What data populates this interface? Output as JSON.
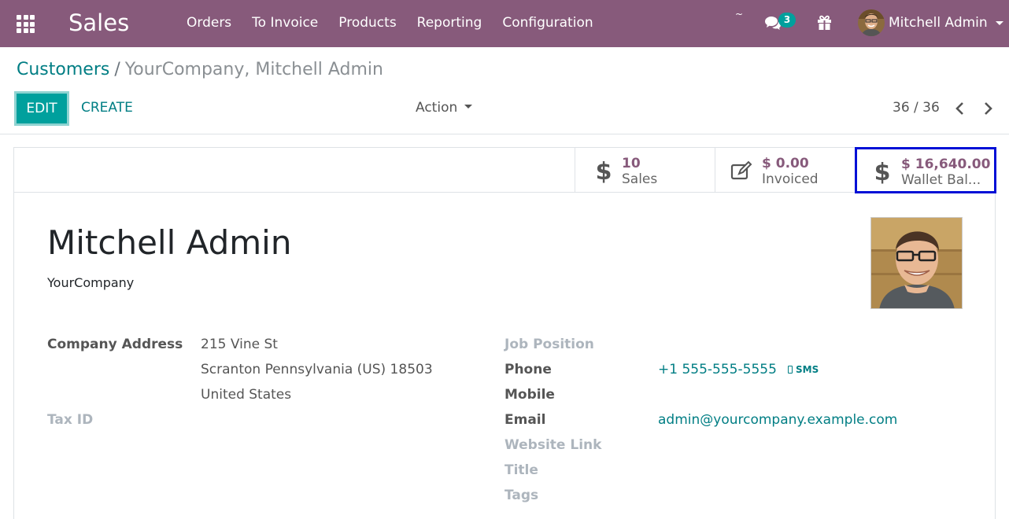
{
  "navbar": {
    "brand": "Sales",
    "menu": [
      "Orders",
      "To Invoice",
      "Products",
      "Reporting",
      "Configuration"
    ],
    "tilde": "~",
    "messages_count": "3",
    "user_name": "Mitchell Admin",
    "colors": {
      "bar": "#875a7b",
      "badge": "#00a09d"
    },
    "icons": [
      "apps-grid-icon",
      "chat-icon",
      "gift-icon",
      "avatar"
    ]
  },
  "breadcrumb": {
    "parent": "Customers",
    "separator": "/",
    "current": "YourCompany, Mitchell Admin"
  },
  "controls": {
    "edit": "EDIT",
    "create": "CREATE",
    "action": "Action",
    "pager": "36 / 36",
    "accent": "#00a09d"
  },
  "stats": {
    "sales": {
      "value": "10",
      "label": "Sales",
      "icon": "dollar-icon"
    },
    "invoiced": {
      "value": "$ 0.00",
      "label": "Invoiced",
      "icon": "edit-icon"
    },
    "wallet": {
      "value": "$ 16,640.00",
      "label": "Wallet Bal...",
      "icon": "dollar-icon"
    }
  },
  "partner": {
    "name": "Mitchell Admin",
    "company": "YourCompany"
  },
  "left_fields": {
    "address_label": "Company Address",
    "street": "215 Vine St",
    "city_line": "Scranton  Pennsylvania (US)  18503",
    "country": "United States",
    "tax_label": "Tax ID"
  },
  "right_fields": {
    "job_label": "Job Position",
    "phone_label": "Phone",
    "phone": "+1 555-555-5555",
    "sms": "SMS",
    "mobile_label": "Mobile",
    "email_label": "Email",
    "email": "admin@yourcompany.example.com",
    "website_label": "Website Link",
    "title_label": "Title",
    "tags_label": "Tags"
  }
}
